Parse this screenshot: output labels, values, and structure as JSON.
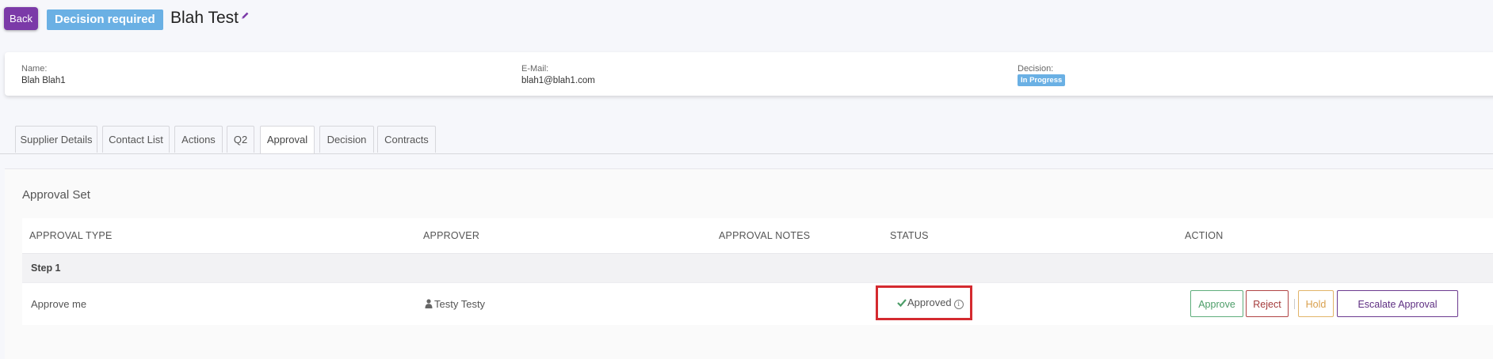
{
  "header": {
    "back_label": "Back",
    "decision_badge": "Decision required",
    "title": "Blah Test"
  },
  "info": {
    "name_label": "Name:",
    "name_value": "Blah Blah1",
    "email_label": "E-Mail:",
    "email_value": "blah1@blah1.com",
    "decision_label": "Decision:",
    "decision_value": "In Progress"
  },
  "tabs": [
    {
      "label": "Supplier Details"
    },
    {
      "label": "Contact List"
    },
    {
      "label": "Actions"
    },
    {
      "label": "Q2"
    },
    {
      "label": "Approval",
      "active": true
    },
    {
      "label": "Decision"
    },
    {
      "label": "Contracts"
    }
  ],
  "approval": {
    "section_title": "Approval Set",
    "columns": [
      "APPROVAL TYPE",
      "APPROVER",
      "APPROVAL NOTES",
      "STATUS",
      "ACTION"
    ],
    "step_label": "Step 1",
    "row": {
      "type": "Approve me",
      "approver": "Testy Testy",
      "notes": "",
      "status": "Approved"
    },
    "actions": {
      "approve": "Approve",
      "reject": "Reject",
      "hold": "Hold",
      "escalate": "Escalate Approval"
    }
  },
  "colors": {
    "accent_purple": "#7b3aa8",
    "badge_blue": "#6ab0e4",
    "highlight_red": "#d42a2f",
    "approved_green": "#4c9d68"
  },
  "icons": {
    "edit": "pencil-icon",
    "approver": "user-icon",
    "status": "check-icon",
    "info": "info-icon"
  }
}
